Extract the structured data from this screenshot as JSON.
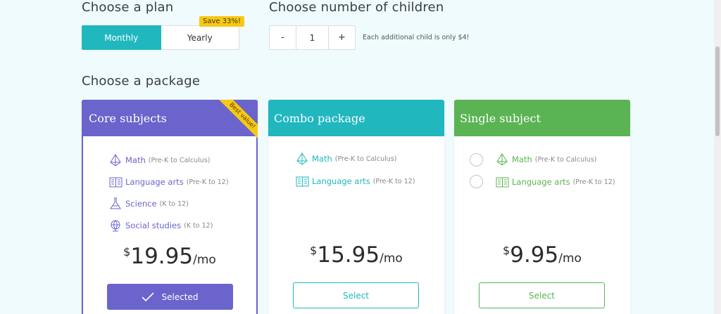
{
  "plan": {
    "heading": "Choose a plan",
    "options": [
      "Monthly",
      "Yearly"
    ],
    "selected": "Monthly",
    "save_badge": "Save 33%!"
  },
  "children": {
    "heading": "Choose number of children",
    "minus": "-",
    "plus": "+",
    "value": "1",
    "note": "Each additional child is only $4!"
  },
  "packages": {
    "heading": "Choose a package",
    "core": {
      "title": "Core subjects",
      "ribbon": "Best value!",
      "subjects": [
        {
          "name": "Math",
          "range": "(Pre-K to Calculus)",
          "icon": "pyramid-icon"
        },
        {
          "name": "Language arts",
          "range": "(Pre-K to 12)",
          "icon": "book-icon"
        },
        {
          "name": "Science",
          "range": "(K to 12)",
          "icon": "flask-icon"
        },
        {
          "name": "Social studies",
          "range": "(K to 12)",
          "icon": "globe-icon"
        }
      ],
      "currency": "$",
      "price": "19.95",
      "period": "/mo",
      "button": "Selected",
      "color": "#6a64cc"
    },
    "combo": {
      "title": "Combo package",
      "subjects": [
        {
          "name": "Math",
          "range": "(Pre-K to Calculus)",
          "icon": "pyramid-icon"
        },
        {
          "name": "Language arts",
          "range": "(Pre-K to 12)",
          "icon": "book-icon"
        }
      ],
      "currency": "$",
      "price": "15.95",
      "period": "/mo",
      "button": "Select",
      "color": "#20b7bf"
    },
    "single": {
      "title": "Single subject",
      "subjects": [
        {
          "name": "Math",
          "range": "(Pre-K to Calculus)",
          "icon": "pyramid-icon"
        },
        {
          "name": "Language arts",
          "range": "(Pre-K to 12)",
          "icon": "book-icon"
        }
      ],
      "currency": "$",
      "price": "9.95",
      "period": "/mo",
      "button": "Select",
      "color": "#5ab453"
    }
  },
  "colors": {
    "accent": "#20b7bf",
    "badge": "#f7c815",
    "background": "#f0fbfd"
  }
}
